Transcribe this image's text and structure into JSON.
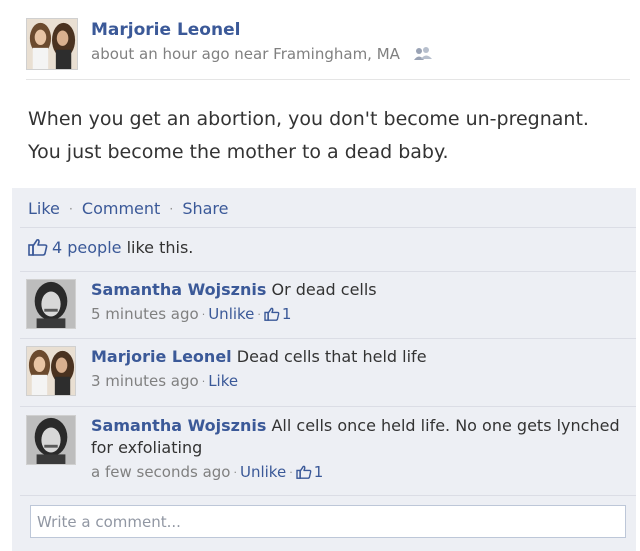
{
  "post": {
    "author": "Marjorie Leonel",
    "meta": "about an hour ago near Framingham, MA",
    "audience_icon": "friends-icon",
    "text": "When you get an abortion, you don't become un-pregnant. You just become the mother to a dead baby."
  },
  "actions": {
    "like": "Like",
    "comment": "Comment",
    "share": "Share",
    "separator": "·"
  },
  "likes": {
    "icon": "thumbs-up-icon",
    "count_label": "4 people",
    "suffix": "like this."
  },
  "comments": [
    {
      "author": "Samantha Wojsznis",
      "text": "Or dead cells",
      "time": "5 minutes ago",
      "action": "Unlike",
      "like_count": "1"
    },
    {
      "author": "Marjorie Leonel",
      "text": "Dead cells that held life",
      "time": "3 minutes ago",
      "action": "Like"
    },
    {
      "author": "Samantha Wojsznis",
      "text": "All cells once held life. No one gets lynched for exfoliating",
      "time": "a few seconds ago",
      "action": "Unlike",
      "like_count": "1"
    }
  ],
  "composer": {
    "placeholder": "Write a comment..."
  },
  "colors": {
    "link": "#3b5998",
    "feedback_bg": "#edeff4",
    "meta_text": "#808080"
  }
}
